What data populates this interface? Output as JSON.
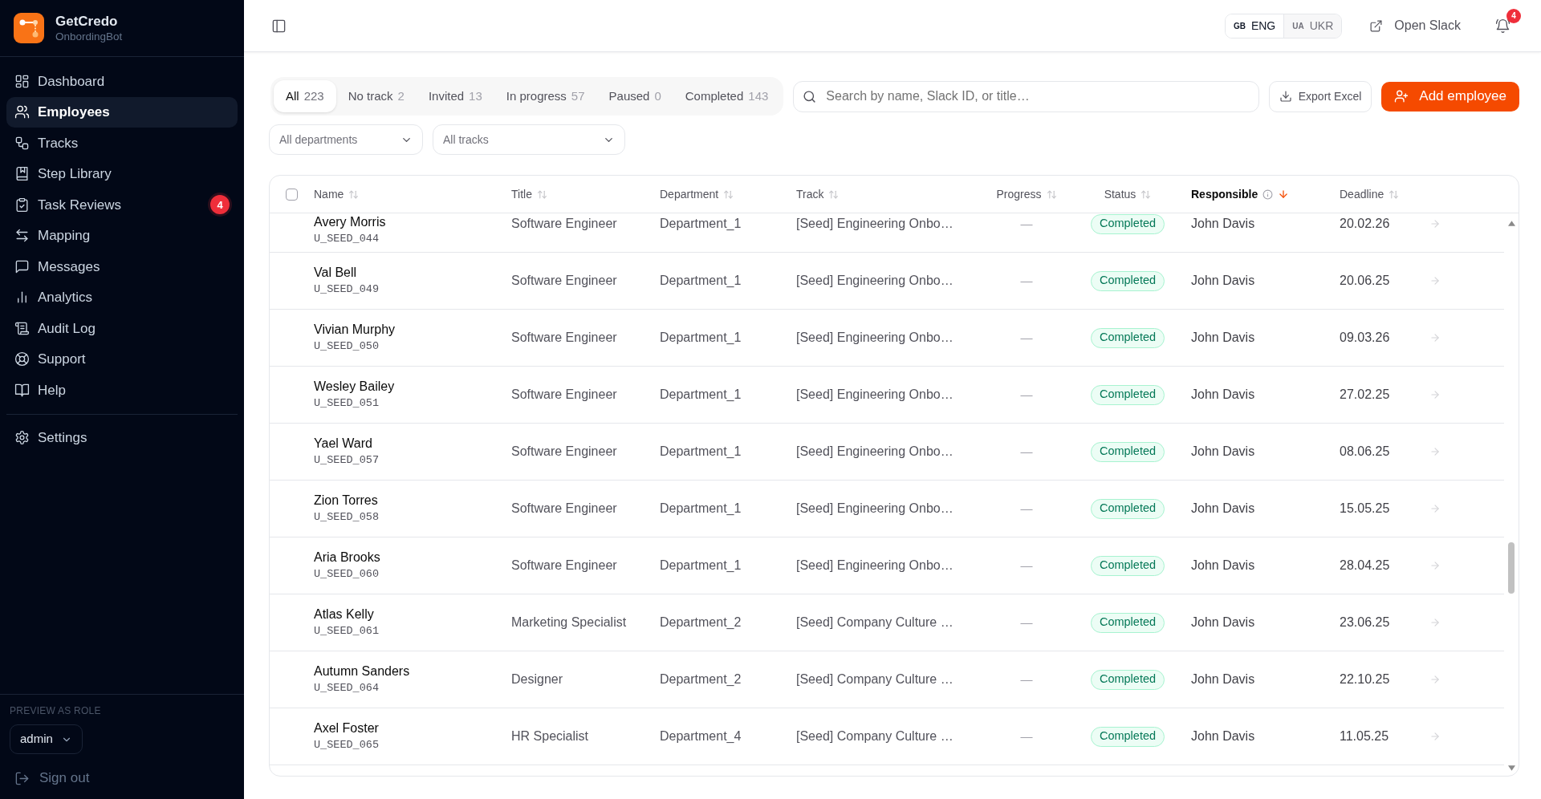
{
  "sidebar": {
    "brand": {
      "name": "GetCredo",
      "subtitle": "OnbordingBot"
    },
    "items": [
      {
        "label": "Dashboard",
        "selected": false
      },
      {
        "label": "Employees",
        "selected": true
      },
      {
        "label": "Tracks",
        "selected": false
      },
      {
        "label": "Step Library",
        "selected": false
      },
      {
        "label": "Task Reviews",
        "selected": false,
        "badge": "4"
      },
      {
        "label": "Mapping",
        "selected": false
      },
      {
        "label": "Messages",
        "selected": false
      },
      {
        "label": "Analytics",
        "selected": false
      },
      {
        "label": "Audit Log",
        "selected": false
      },
      {
        "label": "Support",
        "selected": false
      },
      {
        "label": "Help",
        "selected": false
      }
    ],
    "footer_items": [
      {
        "label": "Settings",
        "selected": false
      }
    ],
    "role_preview": {
      "label": "PREVIEW AS ROLE",
      "value": "admin"
    },
    "sign_out": "Sign out"
  },
  "top_bar": {
    "languages": [
      {
        "code": "GB",
        "label": "ENG",
        "selected": true
      },
      {
        "code": "UA",
        "label": "UKR",
        "selected": false
      }
    ],
    "open_slack": "Open Slack",
    "notifications_badge": "4"
  },
  "filters": {
    "tabs": [
      {
        "label": "All",
        "count": "223",
        "selected": true
      },
      {
        "label": "No track",
        "count": "2",
        "selected": false
      },
      {
        "label": "Invited",
        "count": "13",
        "selected": false
      },
      {
        "label": "In progress",
        "count": "57",
        "selected": false
      },
      {
        "label": "Paused",
        "count": "0",
        "selected": false
      },
      {
        "label": "Completed",
        "count": "143",
        "selected": false
      }
    ],
    "search": {
      "placeholder": "Search by name, Slack ID, or title…"
    },
    "export_button": "Export Excel",
    "add_button": "Add employee",
    "dropdowns": [
      {
        "value": "All departments"
      },
      {
        "value": "All tracks"
      }
    ]
  },
  "table": {
    "select_all": {
      "checked": false
    },
    "columns": [
      {
        "label": "Name",
        "sorted": false
      },
      {
        "label": "Title",
        "sorted": false
      },
      {
        "label": "Department",
        "sorted": false
      },
      {
        "label": "Track",
        "sorted": false
      },
      {
        "label": "Progress",
        "sorted": false
      },
      {
        "label": "Status",
        "sorted": false
      },
      {
        "label": "Responsible",
        "sorted": true,
        "descending": true,
        "info": true
      },
      {
        "label": "Deadline",
        "sorted": false
      }
    ],
    "rows": [
      {
        "name": "Avery Morris",
        "employee_id": "U_SEED_044",
        "title": "Software Engineer",
        "department": "Department_1",
        "track": "[Seed] Engineering Onbo…",
        "progress": "—",
        "status": "Completed",
        "responsible": "John Davis",
        "deadline": "20.02.26"
      },
      {
        "name": "Val Bell",
        "employee_id": "U_SEED_049",
        "title": "Software Engineer",
        "department": "Department_1",
        "track": "[Seed] Engineering Onbo…",
        "progress": "—",
        "status": "Completed",
        "responsible": "John Davis",
        "deadline": "20.06.25"
      },
      {
        "name": "Vivian Murphy",
        "employee_id": "U_SEED_050",
        "title": "Software Engineer",
        "department": "Department_1",
        "track": "[Seed] Engineering Onbo…",
        "progress": "—",
        "status": "Completed",
        "responsible": "John Davis",
        "deadline": "09.03.26"
      },
      {
        "name": "Wesley Bailey",
        "employee_id": "U_SEED_051",
        "title": "Software Engineer",
        "department": "Department_1",
        "track": "[Seed] Engineering Onbo…",
        "progress": "—",
        "status": "Completed",
        "responsible": "John Davis",
        "deadline": "27.02.25"
      },
      {
        "name": "Yael Ward",
        "employee_id": "U_SEED_057",
        "title": "Software Engineer",
        "department": "Department_1",
        "track": "[Seed] Engineering Onbo…",
        "progress": "—",
        "status": "Completed",
        "responsible": "John Davis",
        "deadline": "08.06.25"
      },
      {
        "name": "Zion Torres",
        "employee_id": "U_SEED_058",
        "title": "Software Engineer",
        "department": "Department_1",
        "track": "[Seed] Engineering Onbo…",
        "progress": "—",
        "status": "Completed",
        "responsible": "John Davis",
        "deadline": "15.05.25"
      },
      {
        "name": "Aria Brooks",
        "employee_id": "U_SEED_060",
        "title": "Software Engineer",
        "department": "Department_1",
        "track": "[Seed] Engineering Onbo…",
        "progress": "—",
        "status": "Completed",
        "responsible": "John Davis",
        "deadline": "28.04.25"
      },
      {
        "name": "Atlas Kelly",
        "employee_id": "U_SEED_061",
        "title": "Marketing Specialist",
        "department": "Department_2",
        "track": "[Seed] Company Culture …",
        "progress": "—",
        "status": "Completed",
        "responsible": "John Davis",
        "deadline": "23.06.25"
      },
      {
        "name": "Autumn Sanders",
        "employee_id": "U_SEED_064",
        "title": "Designer",
        "department": "Department_2",
        "track": "[Seed] Company Culture …",
        "progress": "—",
        "status": "Completed",
        "responsible": "John Davis",
        "deadline": "22.10.25"
      },
      {
        "name": "Axel Foster",
        "employee_id": "U_SEED_065",
        "title": "HR Specialist",
        "department": "Department_4",
        "track": "[Seed] Company Culture …",
        "progress": "—",
        "status": "Completed",
        "responsible": "John Davis",
        "deadline": "11.05.25"
      }
    ]
  }
}
